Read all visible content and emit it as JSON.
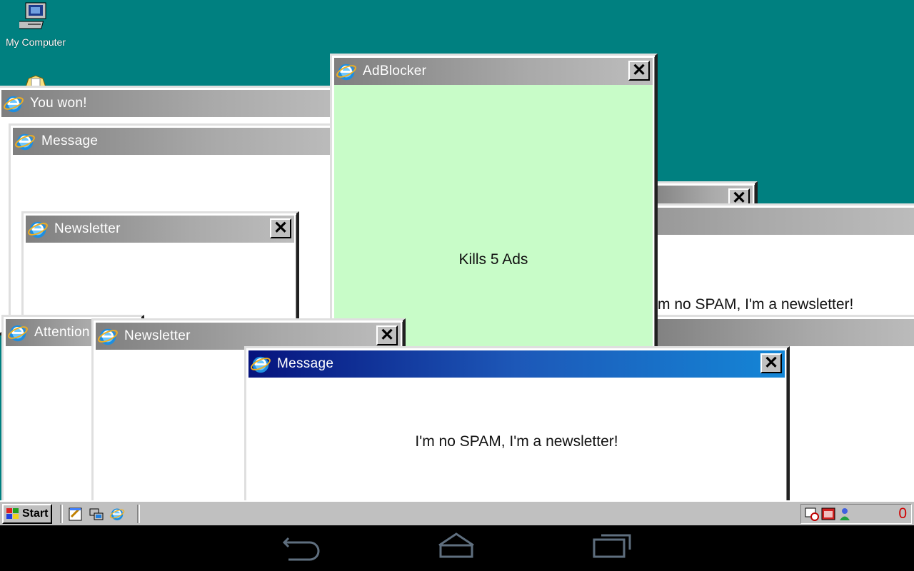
{
  "desktop": {
    "icons": [
      {
        "label": "My Computer",
        "icon": "my-computer-icon"
      },
      {
        "label": "",
        "icon": "folder-icon"
      }
    ]
  },
  "windows": {
    "you_won": {
      "title": "You won!"
    },
    "message_back": {
      "title": "Message"
    },
    "newsletter_1": {
      "title": "Newsletter"
    },
    "adblocker": {
      "title": "AdBlocker",
      "body": "Kills 5 Ads"
    },
    "spam_right": {
      "body": "m no SPAM, I'm a newsletter!"
    },
    "attention": {
      "title": "Attention"
    },
    "newsletter_2": {
      "title": "Newsletter"
    },
    "message_active": {
      "title": "Message",
      "body": "I'm no SPAM, I'm a newsletter!"
    }
  },
  "taskbar": {
    "start_label": "Start",
    "quick_launch": [
      "notepad-icon",
      "network-icon",
      "ie-icon"
    ],
    "tray_icons": [
      "scheduler-icon",
      "calendar-icon",
      "user-icon"
    ],
    "counter": "0"
  },
  "navbar": {
    "buttons": [
      "back-icon",
      "home-icon",
      "recent-apps-icon"
    ]
  },
  "colors": {
    "desktop": "#008080",
    "inactive_title": "#808080",
    "active_title_start": "#06137d",
    "active_title_end": "#1486d6",
    "adblocker_body": "#c8fcc8",
    "counter": "#d00000"
  }
}
